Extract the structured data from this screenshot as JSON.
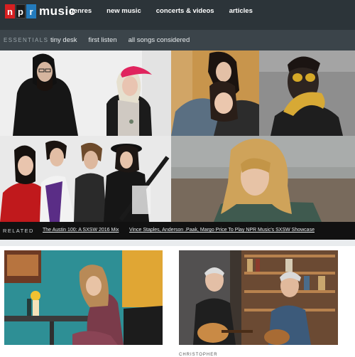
{
  "brand": {
    "letters": [
      "n",
      "p",
      "r"
    ],
    "word": "music"
  },
  "nav": {
    "items": [
      "genres",
      "new music",
      "concerts & videos",
      "articles"
    ]
  },
  "essentials": {
    "label": "ESSENTIALS",
    "links": [
      "tiny desk",
      "first listen",
      "all songs considered"
    ]
  },
  "related": {
    "label": "RELATED",
    "links": [
      "The Austin 100: A SXSW 2016 Mix",
      "Vince Staples, Anderson .Paak, Margo Price To Play NPR Music's SXSW Showcase"
    ]
  },
  "bottom_cards": {
    "caption_right": "CHRISTOPHER"
  },
  "colors": {
    "topbar": "#2c3439",
    "subbar": "#3b444a",
    "npr_red": "#d62021",
    "npr_blue": "#237bbd"
  }
}
